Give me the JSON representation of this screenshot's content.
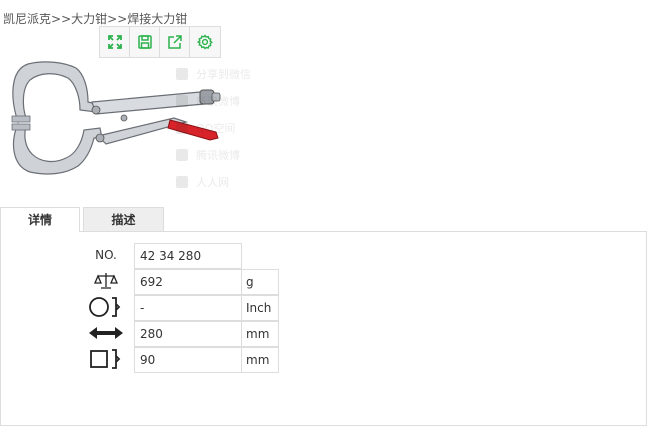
{
  "breadcrumb": {
    "items": [
      "凯尼派克",
      "大力钳",
      "焊接大力钳"
    ],
    "separator": ">>"
  },
  "toolbar": {
    "buttons": [
      "fullscreen-icon",
      "save-icon",
      "share-icon",
      "settings-icon"
    ],
    "accent_color": "#2bb24c"
  },
  "share_panel": {
    "items": [
      "分享到微信",
      "新浪微博",
      "QQ空间",
      "腾讯微博",
      "人人网"
    ]
  },
  "tabs": [
    {
      "label": "详情",
      "active": true
    },
    {
      "label": "描述",
      "active": false
    }
  ],
  "specs": {
    "no_label": "NO.",
    "no_value": "42 34 280",
    "weight_value": "692",
    "weight_unit": "g",
    "capacity_value": "-",
    "capacity_unit": "Inch",
    "length_value": "280",
    "length_unit": "mm",
    "jaw_value": "90",
    "jaw_unit": "mm"
  }
}
